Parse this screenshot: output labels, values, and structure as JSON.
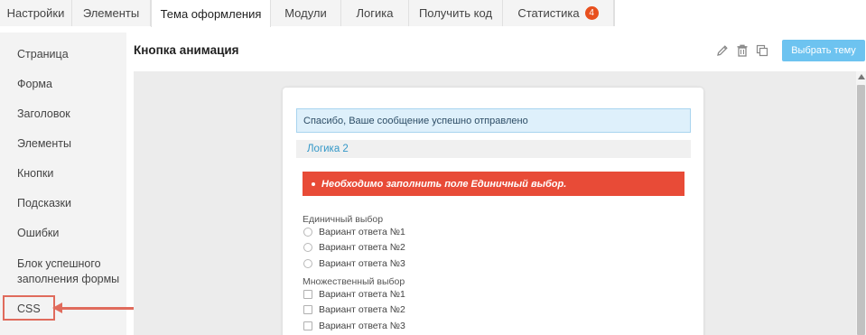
{
  "tabs": [
    {
      "label": "Настройки"
    },
    {
      "label": "Элементы"
    },
    {
      "label": "Тема оформления",
      "active": true
    },
    {
      "label": "Модули"
    },
    {
      "label": "Логика"
    },
    {
      "label": "Получить код"
    },
    {
      "label": "Статистика",
      "badge": "4"
    }
  ],
  "sidebar": {
    "items": [
      {
        "label": "Страница"
      },
      {
        "label": "Форма"
      },
      {
        "label": "Заголовок"
      },
      {
        "label": "Элементы"
      },
      {
        "label": "Кнопки"
      },
      {
        "label": "Подсказки"
      },
      {
        "label": "Ошибки"
      },
      {
        "label": "Блок успешного заполнения формы"
      },
      {
        "label": "CSS",
        "highlighted": true
      }
    ]
  },
  "header": {
    "title": "Кнопка анимация",
    "icons": [
      "pencil-icon",
      "trash-icon",
      "copy-icon"
    ],
    "select_theme_label": "Выбрать тему"
  },
  "preview": {
    "success_message": "Спасибо, Ваше сообщение успешно отправлено",
    "logic_label": "Логика 2",
    "error_message": "Необходимо заполнить поле Единичный выбор.",
    "single_choice": {
      "label": "Единичный выбор",
      "options": [
        "Вариант ответа №1",
        "Вариант ответа №2",
        "Вариант ответа №3"
      ]
    },
    "multiple_choice": {
      "label": "Множественный выбор",
      "options": [
        "Вариант ответа №1",
        "Вариант ответа №2",
        "Вариант ответа №3"
      ]
    }
  },
  "colors": {
    "accent_button": "#6dc3f0",
    "error": "#e84b37",
    "badge": "#e8501e",
    "highlight": "#e06b5c",
    "link": "#3498c8"
  }
}
